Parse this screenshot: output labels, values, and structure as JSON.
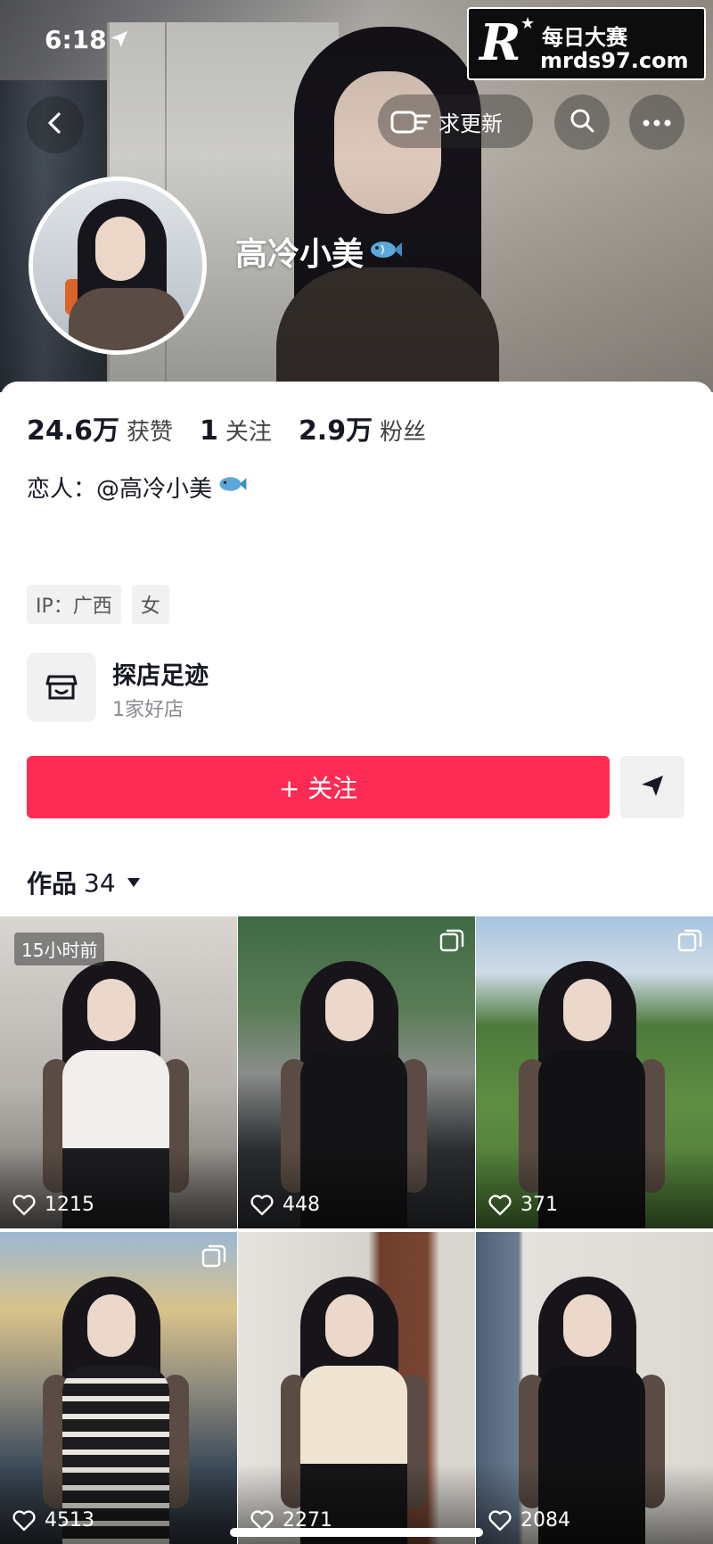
{
  "status_bar": {
    "time": "6:18",
    "location_icon": "location-arrow-icon"
  },
  "watermark": {
    "logo": "R",
    "star": "★",
    "text": "每日大赛",
    "url": "mrds97.com"
  },
  "top_bar": {
    "back_icon": "back-chevron-icon",
    "update_label": "求更新",
    "update_icon": "pointing-hand-icon",
    "search_icon": "search-icon",
    "more_icon": "more-dots-icon"
  },
  "profile": {
    "username": "高冷小美",
    "username_emoji": "fish-icon",
    "stats": [
      {
        "value": "24.6万",
        "label": "获赞"
      },
      {
        "value": "1",
        "label": "关注"
      },
      {
        "value": "2.9万",
        "label": "粉丝"
      }
    ],
    "bio": "恋人：@高冷小美",
    "tags": [
      "IP：广西",
      "女"
    ],
    "shop": {
      "title": "探店足迹",
      "subtitle": "1家好店",
      "icon": "store-icon"
    },
    "follow_label": "+ 关注",
    "share_icon": "share-arrow-icon"
  },
  "works": {
    "label": "作品",
    "count": "34",
    "dropdown_icon": "caret-down-icon",
    "items": [
      {
        "likes": "1215",
        "badge": "15小时前",
        "multi": false
      },
      {
        "likes": "448",
        "badge": "",
        "multi": true
      },
      {
        "likes": "371",
        "badge": "",
        "multi": true
      },
      {
        "likes": "4513",
        "badge": "",
        "multi": true
      },
      {
        "likes": "2271",
        "badge": "",
        "multi": false
      },
      {
        "likes": "2084",
        "badge": "",
        "multi": false
      }
    ]
  },
  "colors": {
    "accent": "#fe2c55",
    "text": "#161823",
    "secondary": "#8a8b91",
    "chip": "#f1f1f2"
  }
}
